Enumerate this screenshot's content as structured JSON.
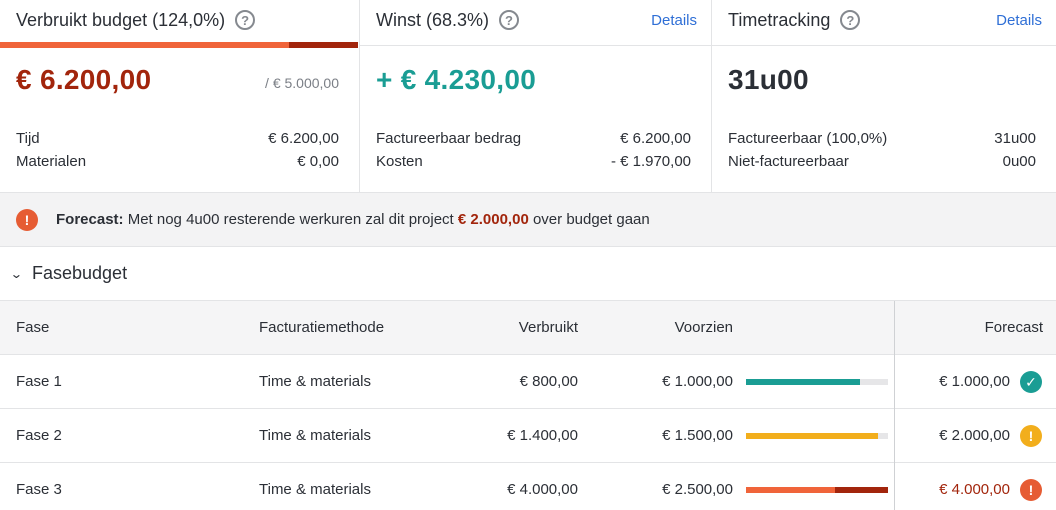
{
  "cards": {
    "budget": {
      "title": "Verbruikt budget (124,0%)",
      "amount": "€ 6.200,00",
      "of_total": "/ € 5.000,00",
      "consumed_fraction": 1.24,
      "rows": [
        {
          "label": "Tijd",
          "value": "€ 6.200,00"
        },
        {
          "label": "Materialen",
          "value": "€ 0,00"
        }
      ]
    },
    "profit": {
      "title": "Winst (68.3%)",
      "details": "Details",
      "amount": "+ € 4.230,00",
      "rows": [
        {
          "label": "Factureerbaar bedrag",
          "value": "€ 6.200,00"
        },
        {
          "label": "Kosten",
          "value": "- € 1.970,00"
        }
      ]
    },
    "time": {
      "title": "Timetracking",
      "details": "Details",
      "amount": "31u00",
      "rows": [
        {
          "label": "Factureerbaar (100,0%)",
          "value": "31u00"
        },
        {
          "label": "Niet-factureerbaar",
          "value": "0u00"
        }
      ]
    }
  },
  "banner": {
    "label": "Forecast:",
    "text_before": "Met nog 4u00 resterende werkuren zal dit project",
    "amount": "€ 2.000,00",
    "text_after": "over budget gaan"
  },
  "section": {
    "title": "Fasebudget"
  },
  "table": {
    "headers": {
      "fase": "Fase",
      "method": "Facturatiemethode",
      "used": "Verbruikt",
      "planned": "Voorzien",
      "forecast": "Forecast"
    },
    "rows": [
      {
        "fase": "Fase 1",
        "method": "Time & materials",
        "used": "€ 800,00",
        "planned": "€ 1.000,00",
        "forecast": "€ 1.000,00",
        "progress": 0.8,
        "status": "ok",
        "icon": "check-icon"
      },
      {
        "fase": "Fase 2",
        "method": "Time & materials",
        "used": "€ 1.400,00",
        "planned": "€ 1.500,00",
        "forecast": "€ 2.000,00",
        "progress": 0.933,
        "status": "warning",
        "icon": "warning-icon"
      },
      {
        "fase": "Fase 3",
        "method": "Time & materials",
        "used": "€ 4.000,00",
        "planned": "€ 2.500,00",
        "forecast": "€ 4.000,00",
        "progress": 1.6,
        "status": "over",
        "icon": "alert-icon"
      }
    ]
  },
  "colors": {
    "accent_red": "#a2250c",
    "accent_orange": "#f0643a",
    "teal": "#1a9d94",
    "yellow": "#f2ae1c",
    "link": "#2f6fd6"
  }
}
